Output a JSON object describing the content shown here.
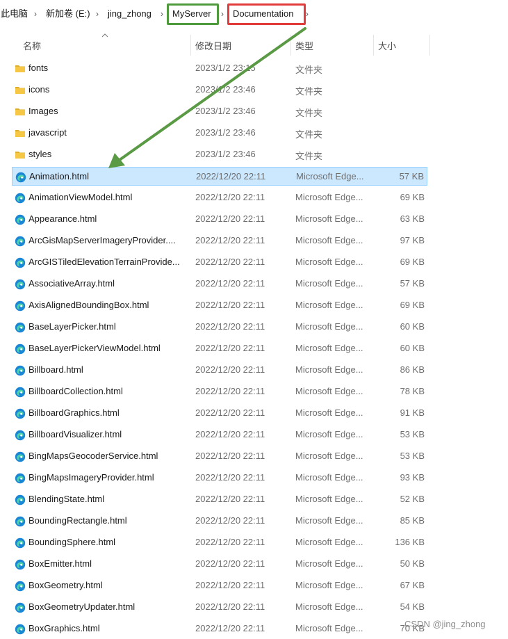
{
  "breadcrumb": {
    "items": [
      "此电脑",
      "新加卷 (E:)",
      "jing_zhong",
      "MyServer",
      "Documentation"
    ]
  },
  "columns": {
    "name": "名称",
    "modified": "修改日期",
    "type": "类型",
    "size": "大小"
  },
  "files": [
    {
      "name": "fonts",
      "date": "2023/1/2 23:15",
      "type": "文件夹",
      "size": "",
      "kind": "folder"
    },
    {
      "name": "icons",
      "date": "2023/1/2 23:46",
      "type": "文件夹",
      "size": "",
      "kind": "folder"
    },
    {
      "name": "Images",
      "date": "2023/1/2 23:46",
      "type": "文件夹",
      "size": "",
      "kind": "folder"
    },
    {
      "name": "javascript",
      "date": "2023/1/2 23:46",
      "type": "文件夹",
      "size": "",
      "kind": "folder"
    },
    {
      "name": "styles",
      "date": "2023/1/2 23:46",
      "type": "文件夹",
      "size": "",
      "kind": "folder"
    },
    {
      "name": "Animation.html",
      "date": "2022/12/20 22:11",
      "type": "Microsoft Edge...",
      "size": "57 KB",
      "kind": "edge",
      "selected": true
    },
    {
      "name": "AnimationViewModel.html",
      "date": "2022/12/20 22:11",
      "type": "Microsoft Edge...",
      "size": "69 KB",
      "kind": "edge"
    },
    {
      "name": "Appearance.html",
      "date": "2022/12/20 22:11",
      "type": "Microsoft Edge...",
      "size": "63 KB",
      "kind": "edge"
    },
    {
      "name": "ArcGisMapServerImageryProvider....",
      "date": "2022/12/20 22:11",
      "type": "Microsoft Edge...",
      "size": "97 KB",
      "kind": "edge"
    },
    {
      "name": "ArcGISTiledElevationTerrainProvide...",
      "date": "2022/12/20 22:11",
      "type": "Microsoft Edge...",
      "size": "69 KB",
      "kind": "edge"
    },
    {
      "name": "AssociativeArray.html",
      "date": "2022/12/20 22:11",
      "type": "Microsoft Edge...",
      "size": "57 KB",
      "kind": "edge"
    },
    {
      "name": "AxisAlignedBoundingBox.html",
      "date": "2022/12/20 22:11",
      "type": "Microsoft Edge...",
      "size": "69 KB",
      "kind": "edge"
    },
    {
      "name": "BaseLayerPicker.html",
      "date": "2022/12/20 22:11",
      "type": "Microsoft Edge...",
      "size": "60 KB",
      "kind": "edge"
    },
    {
      "name": "BaseLayerPickerViewModel.html",
      "date": "2022/12/20 22:11",
      "type": "Microsoft Edge...",
      "size": "60 KB",
      "kind": "edge"
    },
    {
      "name": "Billboard.html",
      "date": "2022/12/20 22:11",
      "type": "Microsoft Edge...",
      "size": "86 KB",
      "kind": "edge"
    },
    {
      "name": "BillboardCollection.html",
      "date": "2022/12/20 22:11",
      "type": "Microsoft Edge...",
      "size": "78 KB",
      "kind": "edge"
    },
    {
      "name": "BillboardGraphics.html",
      "date": "2022/12/20 22:11",
      "type": "Microsoft Edge...",
      "size": "91 KB",
      "kind": "edge"
    },
    {
      "name": "BillboardVisualizer.html",
      "date": "2022/12/20 22:11",
      "type": "Microsoft Edge...",
      "size": "53 KB",
      "kind": "edge"
    },
    {
      "name": "BingMapsGeocoderService.html",
      "date": "2022/12/20 22:11",
      "type": "Microsoft Edge...",
      "size": "53 KB",
      "kind": "edge"
    },
    {
      "name": "BingMapsImageryProvider.html",
      "date": "2022/12/20 22:11",
      "type": "Microsoft Edge...",
      "size": "93 KB",
      "kind": "edge"
    },
    {
      "name": "BlendingState.html",
      "date": "2022/12/20 22:11",
      "type": "Microsoft Edge...",
      "size": "52 KB",
      "kind": "edge"
    },
    {
      "name": "BoundingRectangle.html",
      "date": "2022/12/20 22:11",
      "type": "Microsoft Edge...",
      "size": "85 KB",
      "kind": "edge"
    },
    {
      "name": "BoundingSphere.html",
      "date": "2022/12/20 22:11",
      "type": "Microsoft Edge...",
      "size": "136 KB",
      "kind": "edge"
    },
    {
      "name": "BoxEmitter.html",
      "date": "2022/12/20 22:11",
      "type": "Microsoft Edge...",
      "size": "50 KB",
      "kind": "edge"
    },
    {
      "name": "BoxGeometry.html",
      "date": "2022/12/20 22:11",
      "type": "Microsoft Edge...",
      "size": "67 KB",
      "kind": "edge"
    },
    {
      "name": "BoxGeometryUpdater.html",
      "date": "2022/12/20 22:11",
      "type": "Microsoft Edge...",
      "size": "54 KB",
      "kind": "edge"
    },
    {
      "name": "BoxGraphics.html",
      "date": "2022/12/20 22:11",
      "type": "Microsoft Edge...",
      "size": "70 KB",
      "kind": "edge"
    }
  ],
  "watermark": "CSDN @jing_zhong",
  "colors": {
    "highlight_green": "#4f9a3d",
    "highlight_red": "#e23b3b",
    "selection": "#cce8ff",
    "folder": "#f4c542",
    "edge": "#1c8ad9"
  }
}
